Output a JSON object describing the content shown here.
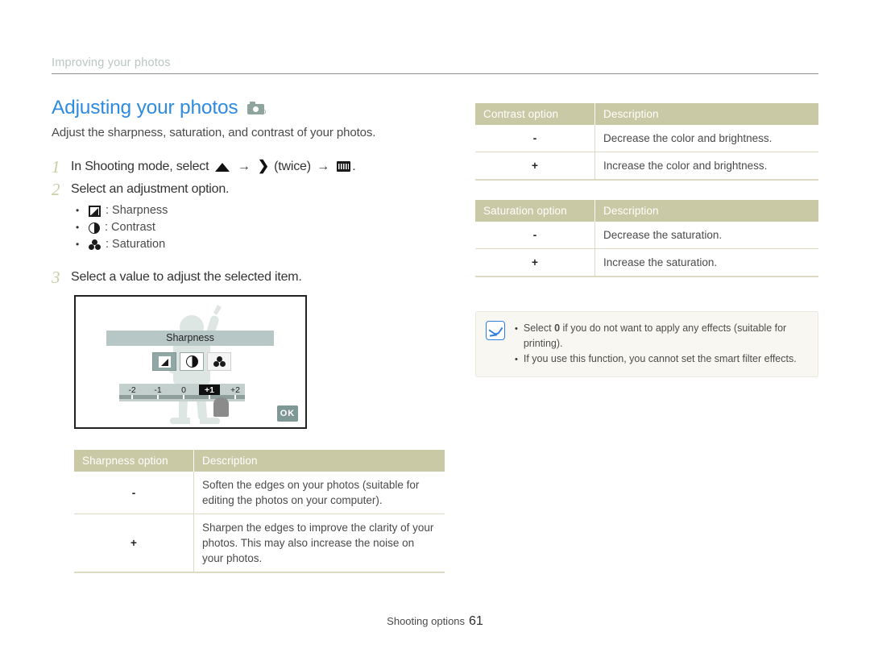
{
  "breadcrumb": "Improving your photos",
  "header": {
    "title": "Adjusting your photos",
    "title_icon": "camera-p-icon",
    "intro": "Adjust the sharpness, saturation, and contrast of your photos."
  },
  "steps": [
    {
      "num": "1",
      "text_before": "In Shooting mode, select",
      "icon1": "up-triangle-icon",
      "arrow1": "→",
      "icon2": "right-chevron-icon",
      "text_mid": "(twice)",
      "arrow2": "→",
      "icon3": "equalizer-bars-icon",
      "text_after": "."
    },
    {
      "num": "2",
      "text": "Select an adjustment option."
    },
    {
      "num": "3",
      "text": "Select a value to adjust the selected item."
    }
  ],
  "bullets": [
    {
      "bullet": "•",
      "icon": "sharpness-icon",
      "label": ": Sharpness"
    },
    {
      "bullet": "•",
      "icon": "contrast-icon",
      "label": ": Contrast"
    },
    {
      "bullet": "•",
      "icon": "saturation-icon",
      "label": ": Saturation"
    }
  ],
  "camera_screen": {
    "label": "Sharpness",
    "options": [
      "sharpness-icon",
      "contrast-icon",
      "saturation-icon"
    ],
    "selected_option_index": 0,
    "focused_option_index": 1,
    "slider_values": [
      "-2",
      "-1",
      "0",
      "+1",
      "+2"
    ],
    "slider_selected": "+1",
    "ok_label": "OK"
  },
  "tables": {
    "sharpness": {
      "headers": [
        "Sharpness option",
        "Description"
      ],
      "rows": [
        {
          "option": "-",
          "description": "Soften the edges on your photos (suitable for editing the photos on your computer)."
        },
        {
          "option": "+",
          "description": "Sharpen the edges to improve the clarity of your photos. This may also increase the noise on your photos."
        }
      ]
    },
    "contrast": {
      "headers": [
        "Contrast option",
        "Description"
      ],
      "rows": [
        {
          "option": "-",
          "description": "Decrease the color and brightness."
        },
        {
          "option": "+",
          "description": "Increase the color and brightness."
        }
      ]
    },
    "saturation": {
      "headers": [
        "Saturation option",
        "Description"
      ],
      "rows": [
        {
          "option": "-",
          "description": "Decrease the saturation."
        },
        {
          "option": "+",
          "description": "Increase the saturation."
        }
      ]
    }
  },
  "note": {
    "icon": "note-pen-icon",
    "items": [
      {
        "bullet": "•",
        "pre": "Select ",
        "strong": "0",
        "post": " if you do not want to apply any effects (suitable for printing)."
      },
      {
        "bullet": "•",
        "pre": "If you use this function, you cannot set the smart filter effects.",
        "strong": "",
        "post": ""
      }
    ]
  },
  "footer": {
    "label": "Shooting options",
    "page": "61"
  },
  "colors": {
    "title_blue": "#2f8be0",
    "breadcrumb": "#b9c6c1",
    "step_number": "#c3cfa4",
    "table_header": "#c9c9a5",
    "table_border": "#ded9c2",
    "note_bg": "#f8f7f2",
    "note_icon": "#2f7fe0",
    "screen_label_bg": "#b7c7c5",
    "slider_bg": "#c3d0cd"
  }
}
